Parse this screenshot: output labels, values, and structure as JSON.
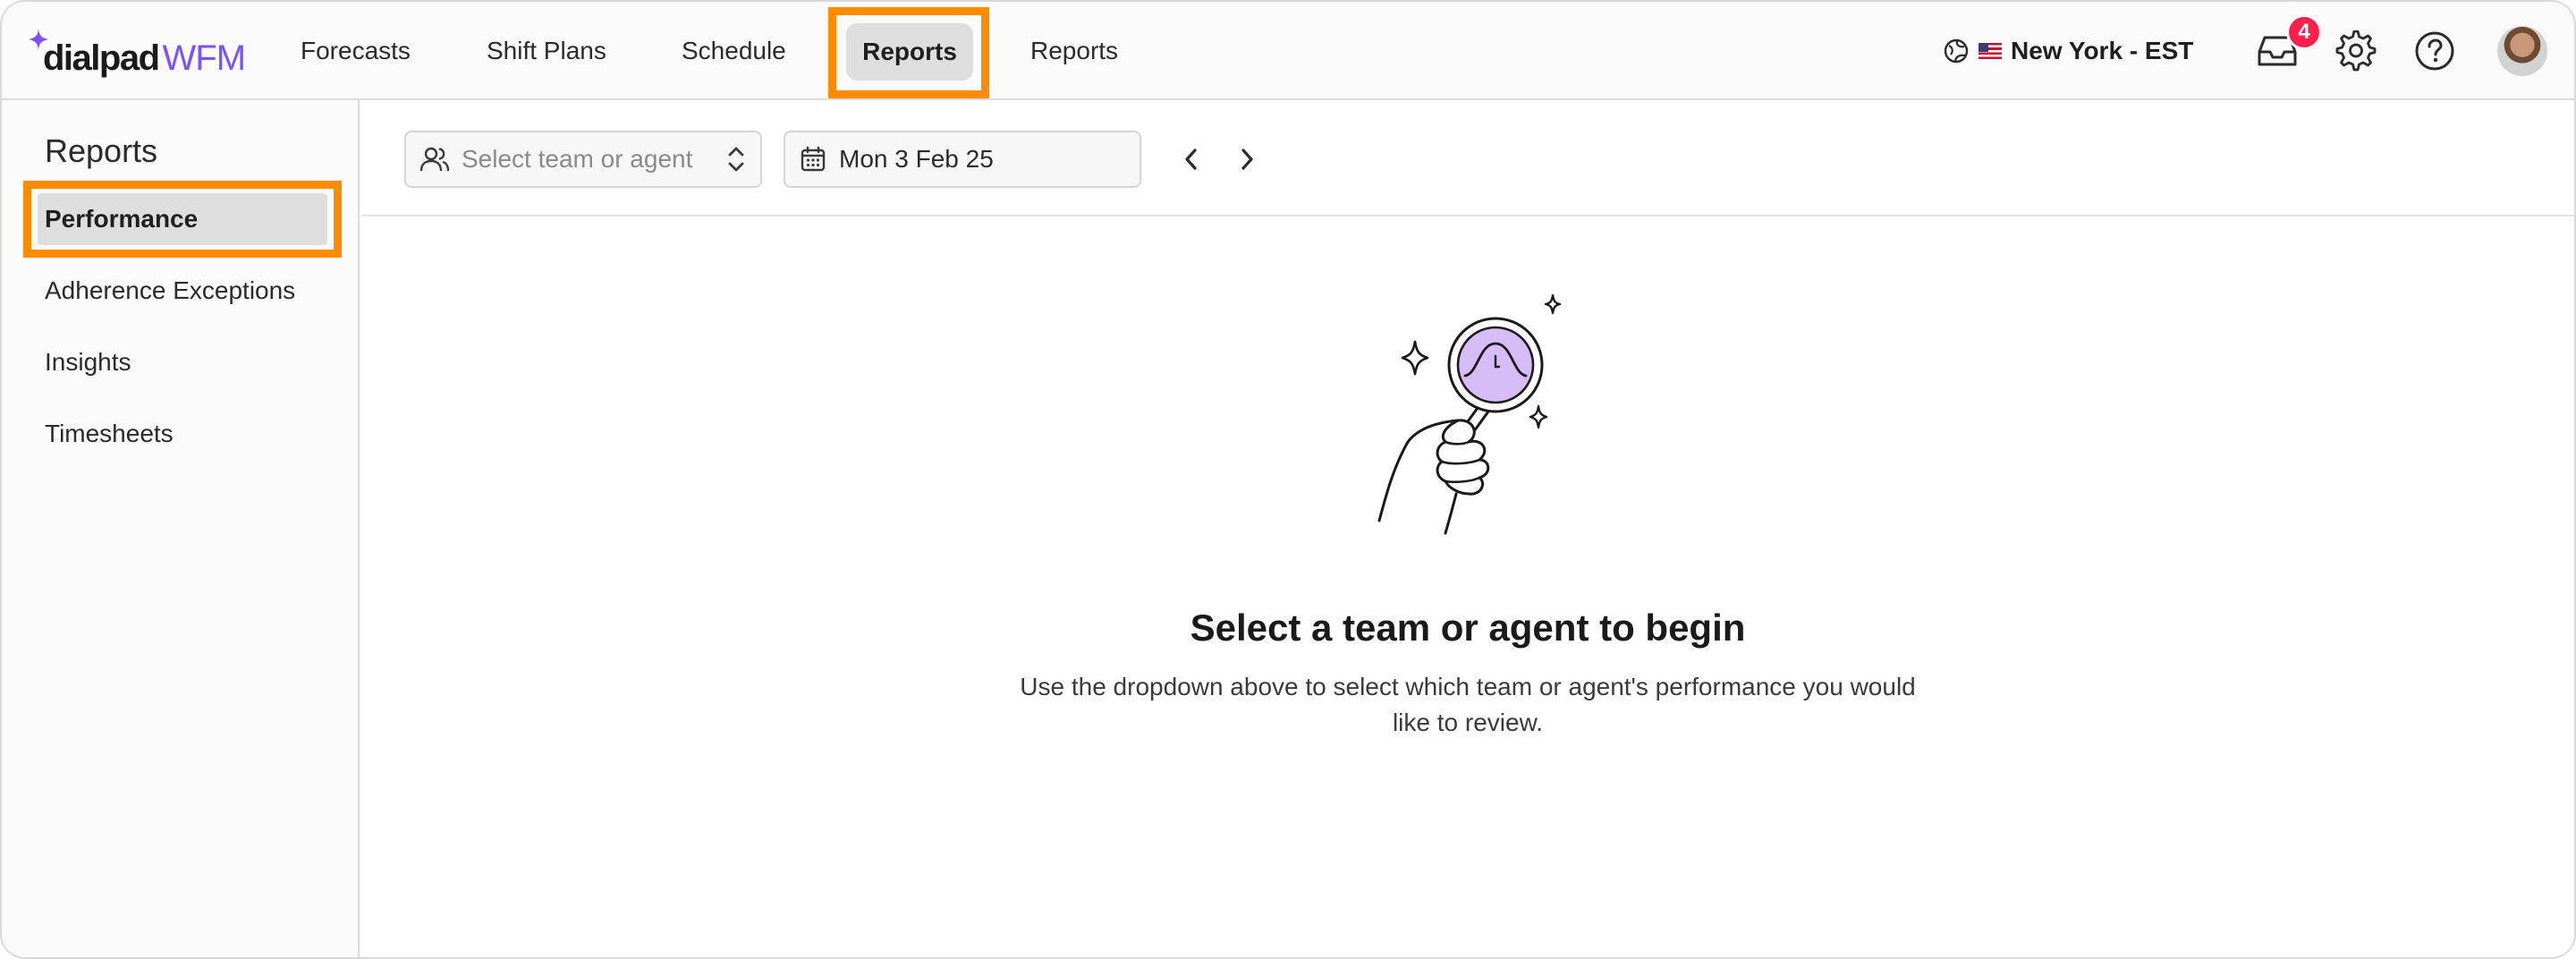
{
  "brand": {
    "name_bold": "dialpad",
    "name_product": "WFM",
    "accent": "#7c52ff"
  },
  "nav": {
    "items": [
      "Forecasts",
      "Shift Plans",
      "Schedule",
      "Reports",
      "Reports"
    ],
    "active_index": 3,
    "highlight_color": "#ff8c00"
  },
  "timezone": {
    "label": "New York - EST"
  },
  "notifications": {
    "count": "4"
  },
  "sidebar": {
    "title": "Reports",
    "items": [
      "Performance",
      "Adherence Exceptions",
      "Insights",
      "Timesheets"
    ],
    "active_index": 0
  },
  "toolbar": {
    "team_select_placeholder": "Select team or agent",
    "date_value": "Mon 3 Feb 25"
  },
  "empty_state": {
    "title": "Select a team or agent to begin",
    "description": "Use the dropdown above to select which team or agent's performance you would like to review."
  },
  "icons": [
    "globe-icon",
    "inbox-icon",
    "gear-icon",
    "help-icon",
    "users-icon",
    "chevron-up-down-icon",
    "calendar-icon",
    "chevron-left-icon",
    "chevron-right-icon"
  ]
}
